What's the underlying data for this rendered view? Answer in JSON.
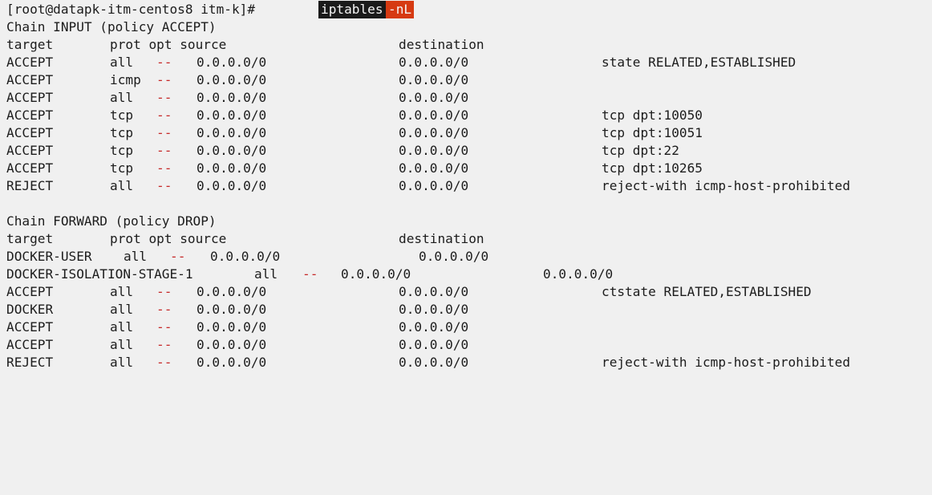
{
  "terminal": {
    "prompt": "[root@datapk-itm-centos8 itm-k]#",
    "command": "iptables",
    "command_flag": "-nL",
    "dash": "--",
    "input_chain": {
      "title": "Chain INPUT (policy ACCEPT)",
      "header": {
        "target": "target",
        "prot_opt_source": "prot opt source",
        "destination": "destination"
      },
      "rules": [
        {
          "target": "ACCEPT",
          "prot": "all",
          "source": "0.0.0.0/0",
          "destination": "0.0.0.0/0",
          "extra": "state RELATED,ESTABLISHED"
        },
        {
          "target": "ACCEPT",
          "prot": "icmp",
          "source": "0.0.0.0/0",
          "destination": "0.0.0.0/0",
          "extra": ""
        },
        {
          "target": "ACCEPT",
          "prot": "all",
          "source": "0.0.0.0/0",
          "destination": "0.0.0.0/0",
          "extra": ""
        },
        {
          "target": "ACCEPT",
          "prot": "tcp",
          "source": "0.0.0.0/0",
          "destination": "0.0.0.0/0",
          "extra": "tcp dpt:10050"
        },
        {
          "target": "ACCEPT",
          "prot": "tcp",
          "source": "0.0.0.0/0",
          "destination": "0.0.0.0/0",
          "extra": "tcp dpt:10051"
        },
        {
          "target": "ACCEPT",
          "prot": "tcp",
          "source": "0.0.0.0/0",
          "destination": "0.0.0.0/0",
          "extra": "tcp dpt:22"
        },
        {
          "target": "ACCEPT",
          "prot": "tcp",
          "source": "0.0.0.0/0",
          "destination": "0.0.0.0/0",
          "extra": "tcp dpt:10265"
        },
        {
          "target": "REJECT",
          "prot": "all",
          "source": "0.0.0.0/0",
          "destination": "0.0.0.0/0",
          "extra": "reject-with icmp-host-prohibited"
        }
      ]
    },
    "forward_chain": {
      "title": "Chain FORWARD (policy DROP)",
      "header": {
        "target": "target",
        "prot_opt_source": "prot opt source",
        "destination": "destination"
      },
      "docker_user": {
        "target": "DOCKER-USER",
        "prot": "all",
        "source": "0.0.0.0/0",
        "destination": "0.0.0.0/0"
      },
      "docker_isolation": {
        "target": "DOCKER-ISOLATION-STAGE-1",
        "prot": "all",
        "source": "0.0.0.0/0",
        "destination": "0.0.0.0/0"
      },
      "rules": [
        {
          "target": "ACCEPT",
          "prot": "all",
          "source": "0.0.0.0/0",
          "destination": "0.0.0.0/0",
          "extra": "ctstate RELATED,ESTABLISHED"
        },
        {
          "target": "DOCKER",
          "prot": "all",
          "source": "0.0.0.0/0",
          "destination": "0.0.0.0/0",
          "extra": ""
        },
        {
          "target": "ACCEPT",
          "prot": "all",
          "source": "0.0.0.0/0",
          "destination": "0.0.0.0/0",
          "extra": ""
        },
        {
          "target": "ACCEPT",
          "prot": "all",
          "source": "0.0.0.0/0",
          "destination": "0.0.0.0/0",
          "extra": ""
        },
        {
          "target": "REJECT",
          "prot": "all",
          "source": "0.0.0.0/0",
          "destination": "0.0.0.0/0",
          "extra": "reject-with icmp-host-prohibited"
        }
      ]
    }
  },
  "colors": {
    "background": "#f0f0f0",
    "text": "#1c1c1c",
    "dash": "#c62828",
    "command_highlight": "#1a1a1a",
    "flag_highlight": "#d63a12"
  }
}
